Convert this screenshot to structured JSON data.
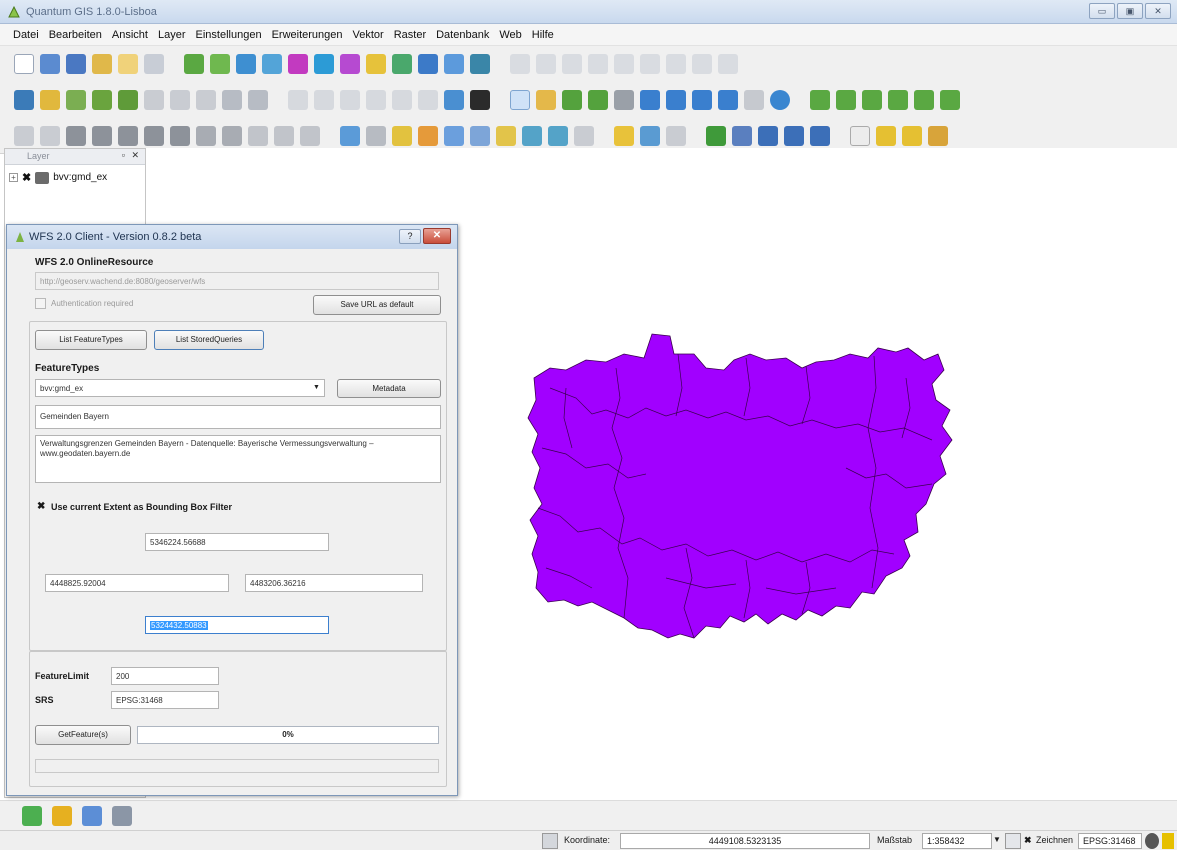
{
  "window": {
    "title": "Quantum GIS 1.8.0-Lisboa",
    "controls": [
      "▭",
      "▣",
      "✕"
    ]
  },
  "menu": [
    "Datei",
    "Bearbeiten",
    "Ansicht",
    "Layer",
    "Einstellungen",
    "Erweiterungen",
    "Vektor",
    "Raster",
    "Datenbank",
    "Web",
    "Hilfe"
  ],
  "layers_panel": {
    "title": "Layer",
    "buttons": "▫ ✕",
    "layer": {
      "name": "bvv:gmd_ex",
      "checked": "✖",
      "expand": "+"
    }
  },
  "dialog": {
    "title": "WFS 2.0 Client - Version 0.8.2 beta",
    "help_btn": "?",
    "close_btn": "✕",
    "online_resource_heading": "WFS 2.0 OnlineResource",
    "online_resource_url": "http://geoserv.wachend.de:8080/geoserver/wfs",
    "auth_label": "Authentication required",
    "save_url_btn": "Save URL as default",
    "list_featuretypes_btn": "List FeatureTypes",
    "list_storedqueries_btn": "List StoredQueries",
    "featuretypes_heading": "FeatureTypes",
    "featuretype_selected": "bvv:gmd_ex",
    "metadata_btn": "Metadata",
    "feature_title": "Gemeinden Bayern",
    "feature_abstract": "Verwaltungsgrenzen Gemeinden Bayern - Datenquelle: Bayerische Vermessungsverwaltung – www.geodaten.bayern.de",
    "bbox_check": "✖",
    "bbox_label": "Use current Extent as Bounding Box Filter",
    "bbox_north": "5346224.56688",
    "bbox_west": "4448825.92004",
    "bbox_east": "4483206.36216",
    "bbox_south": "5324432.50883",
    "featurelimit_label": "FeatureLimit",
    "featurelimit_value": "200",
    "srs_label": "SRS",
    "srs_value": "EPSG:31468",
    "getfeature_btn": "GetFeature(s)",
    "progress_text": "0%",
    "progress_value": 0
  },
  "statusbar": {
    "coord_label": "Koordinate:",
    "coord_value": "4449108.5323135",
    "scale_label": "Maßstab",
    "scale_value": "1:358432",
    "render_label": "Zeichnen",
    "render_check": "✖",
    "crs": "EPSG:31468"
  },
  "colors": {
    "polygon_fill": "#a100ff",
    "polygon_stroke": "#3a004f"
  }
}
